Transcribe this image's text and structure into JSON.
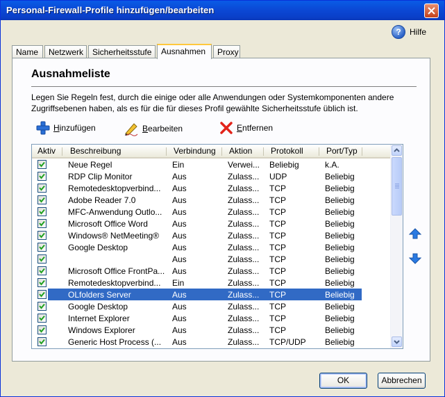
{
  "window": {
    "title": "Personal-Firewall-Profile hinzufügen/bearbeiten"
  },
  "help": {
    "label": "Hilfe"
  },
  "tabs": [
    {
      "label": "Name"
    },
    {
      "label": "Netzwerk"
    },
    {
      "label": "Sicherheitsstufe"
    },
    {
      "label": "Ausnahmen",
      "active": true
    },
    {
      "label": "Proxy"
    }
  ],
  "section": {
    "title": "Ausnahmeliste",
    "description_line1": "Legen Sie Regeln fest, durch die einige oder alle Anwendungen oder Systemkomponenten andere",
    "description_line2": "Zugriffsebenen haben, als es für die für dieses Profil gewählte Sicherheitsstufe üblich ist."
  },
  "toolbar": {
    "add_underlined": "H",
    "add_rest": "inzufügen",
    "edit_underlined": "B",
    "edit_rest": "earbeiten",
    "remove_underlined": "E",
    "remove_rest": "ntfernen"
  },
  "table": {
    "columns": [
      "Aktiv",
      "Beschreibung",
      "Verbindung",
      "Aktion",
      "Protokoll",
      "Port/Typ"
    ],
    "rows": [
      {
        "active": true,
        "description": "Neue Regel",
        "connection": "Ein",
        "action": "Verwei...",
        "protocol": "Beliebig",
        "port": "k.A."
      },
      {
        "active": true,
        "description": "RDP Clip Monitor",
        "connection": "Aus",
        "action": "Zulass...",
        "protocol": "UDP",
        "port": "Beliebig"
      },
      {
        "active": true,
        "description": "Remotedesktopverbind...",
        "connection": "Aus",
        "action": "Zulass...",
        "protocol": "TCP",
        "port": "Beliebig"
      },
      {
        "active": true,
        "description": "Adobe Reader 7.0",
        "connection": "Aus",
        "action": "Zulass...",
        "protocol": "TCP",
        "port": "Beliebig"
      },
      {
        "active": true,
        "description": "MFC-Anwendung Outlo...",
        "connection": "Aus",
        "action": "Zulass...",
        "protocol": "TCP",
        "port": "Beliebig"
      },
      {
        "active": true,
        "description": "Microsoft Office Word",
        "connection": "Aus",
        "action": "Zulass...",
        "protocol": "TCP",
        "port": "Beliebig"
      },
      {
        "active": true,
        "description": "Windows® NetMeeting®",
        "connection": "Aus",
        "action": "Zulass...",
        "protocol": "TCP",
        "port": "Beliebig"
      },
      {
        "active": true,
        "description": "Google Desktop",
        "connection": "Aus",
        "action": "Zulass...",
        "protocol": "TCP",
        "port": "Beliebig"
      },
      {
        "active": true,
        "description": "",
        "connection": "Aus",
        "action": "Zulass...",
        "protocol": "TCP",
        "port": "Beliebig"
      },
      {
        "active": true,
        "description": "Microsoft Office FrontPa...",
        "connection": "Aus",
        "action": "Zulass...",
        "protocol": "TCP",
        "port": "Beliebig"
      },
      {
        "active": true,
        "description": "Remotedesktopverbind...",
        "connection": "Ein",
        "action": "Zulass...",
        "protocol": "TCP",
        "port": "Beliebig"
      },
      {
        "active": true,
        "description": "OLfolders Server",
        "connection": "Aus",
        "action": "Zulass...",
        "protocol": "TCP",
        "port": "Beliebig",
        "selected": true
      },
      {
        "active": true,
        "description": "Google Desktop",
        "connection": "Aus",
        "action": "Zulass...",
        "protocol": "TCP",
        "port": "Beliebig"
      },
      {
        "active": true,
        "description": "Internet Explorer",
        "connection": "Aus",
        "action": "Zulass...",
        "protocol": "TCP",
        "port": "Beliebig"
      },
      {
        "active": true,
        "description": "Windows Explorer",
        "connection": "Aus",
        "action": "Zulass...",
        "protocol": "TCP",
        "port": "Beliebig"
      },
      {
        "active": true,
        "description": "Generic Host Process (...",
        "connection": "Aus",
        "action": "Zulass...",
        "protocol": "TCP/UDP",
        "port": "Beliebig"
      }
    ]
  },
  "buttons": {
    "ok": "OK",
    "cancel": "Abbrechen"
  },
  "colors": {
    "title_bar": "#0a4cd6",
    "selection": "#316ac5",
    "active_tab_accent": "#ffc83c",
    "window_bg": "#ece9d8"
  }
}
